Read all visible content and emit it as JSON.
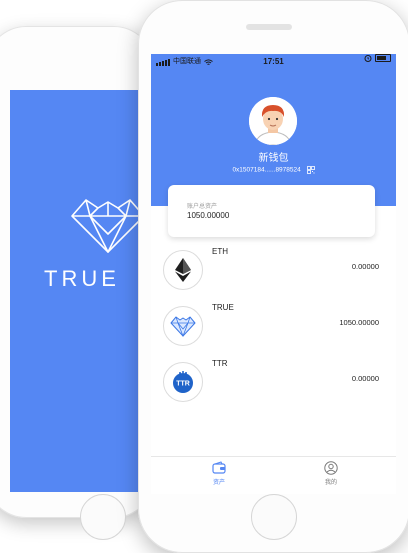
{
  "splash": {
    "brand_text": "TRUE",
    "logo_icon": "diamond-heart-icon"
  },
  "status_bar": {
    "carrier": "中国联通",
    "time": "17:51"
  },
  "wallet": {
    "name": "新钱包",
    "address": "0x1507184......8978524",
    "total_label": "账户总资产",
    "total_value": "1050.00000"
  },
  "tokens": [
    {
      "symbol": "ETH",
      "amount": "0.00000",
      "icon": "ethereum-icon"
    },
    {
      "symbol": "TRUE",
      "amount": "1050.00000",
      "icon": "diamond-heart-icon"
    },
    {
      "symbol": "TTR",
      "amount": "0.00000",
      "icon": "ttr-coin-icon"
    }
  ],
  "tabs": [
    {
      "label": "资产",
      "icon": "wallet-icon",
      "active": true
    },
    {
      "label": "我的",
      "icon": "user-icon",
      "active": false
    }
  ],
  "colors": {
    "accent": "#5587f3",
    "text": "#222222",
    "muted": "#9a9a9a"
  }
}
